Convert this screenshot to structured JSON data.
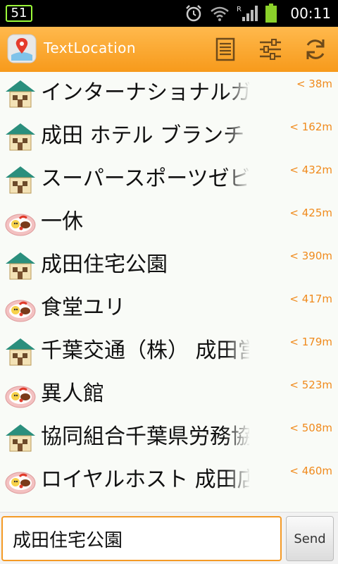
{
  "status_bar": {
    "badge": "51",
    "time": "00:11",
    "icons": [
      "alarm-icon",
      "wifi-icon",
      "roaming-r-icon",
      "signal-icon",
      "battery-icon"
    ]
  },
  "app_bar": {
    "title": "TextLocation",
    "icons": [
      "map-pin-logo-icon",
      "list-icon",
      "settings-sliders-icon",
      "refresh-icon"
    ],
    "accent": "#f79a1b"
  },
  "places": [
    {
      "name": "インターナショナルガ",
      "distance": "< 38m",
      "icon": "house-icon"
    },
    {
      "name": "成田 ホテル ブランチ",
      "distance": "< 162m",
      "icon": "house-icon"
    },
    {
      "name": "スーパースポーツゼビ",
      "distance": "< 432m",
      "icon": "house-icon"
    },
    {
      "name": "一休",
      "distance": "< 425m",
      "icon": "food-plate-icon"
    },
    {
      "name": "成田住宅公園",
      "distance": "< 390m",
      "icon": "house-icon"
    },
    {
      "name": "食堂ユリ",
      "distance": "< 417m",
      "icon": "food-plate-icon"
    },
    {
      "name": "千葉交通（株） 成田営",
      "distance": "< 179m",
      "icon": "house-icon"
    },
    {
      "name": "異人館",
      "distance": "< 523m",
      "icon": "food-plate-icon"
    },
    {
      "name": "協同組合千葉県労務協会",
      "distance": "< 508m",
      "icon": "house-icon"
    },
    {
      "name": "ロイヤルホスト 成田店",
      "distance": "< 460m",
      "icon": "food-plate-icon"
    }
  ],
  "message": {
    "value": "成田住宅公園",
    "send_label": "Send"
  }
}
